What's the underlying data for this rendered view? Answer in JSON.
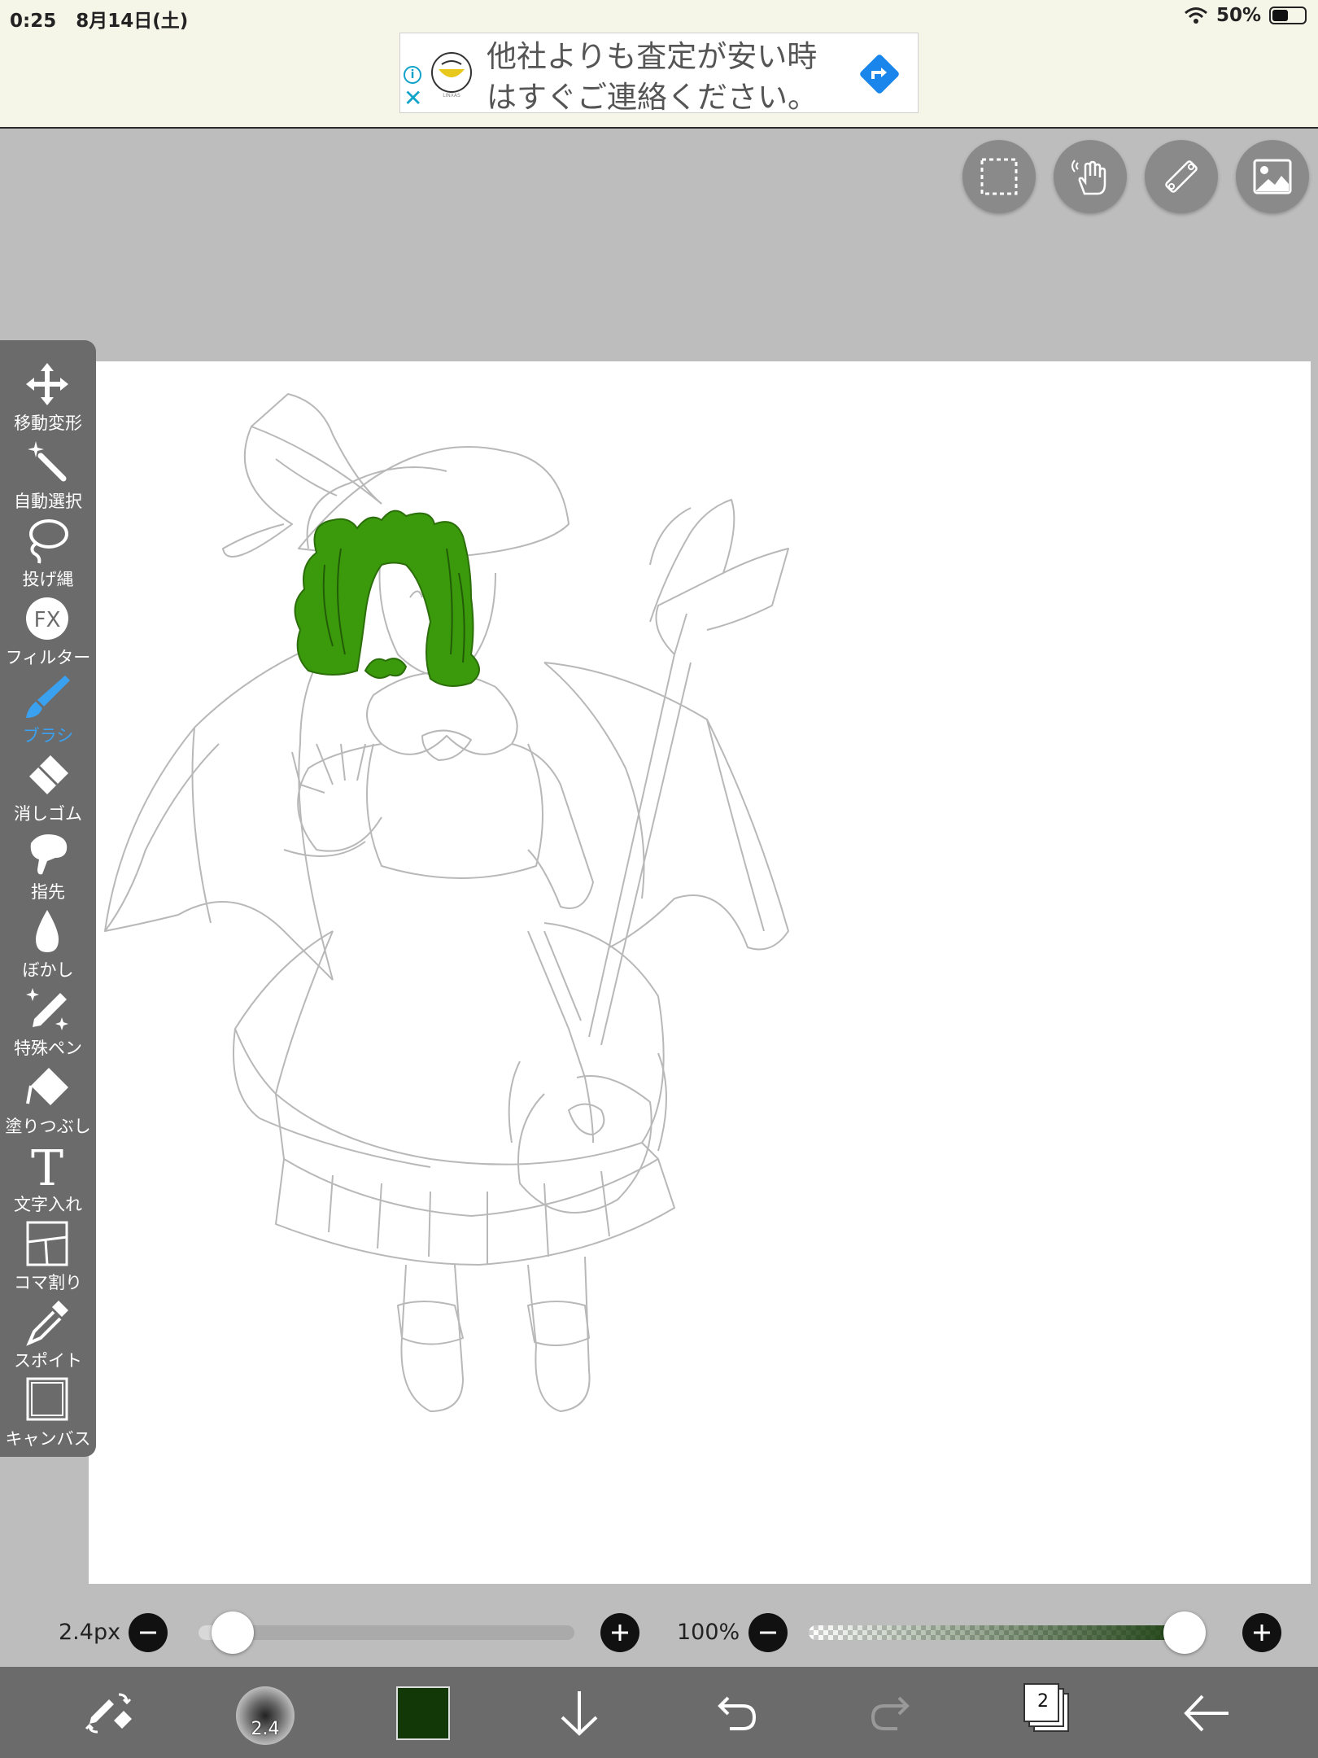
{
  "status": {
    "time": "0:25",
    "date": "8月14日(土)",
    "battery": "50%",
    "battery_level": 0.5
  },
  "ad": {
    "text": "他社よりも査定が安い時はすぐご連絡ください。",
    "info_icon": "i",
    "close_icon": "✕",
    "logo_text": "LINXAS"
  },
  "top_tools": [
    {
      "name": "selection-rect-icon"
    },
    {
      "name": "hand-gesture-icon"
    },
    {
      "name": "ruler-icon"
    },
    {
      "name": "image-material-icon"
    }
  ],
  "toolbar": {
    "items": [
      {
        "label": "移動変形",
        "icon": "move-transform-icon"
      },
      {
        "label": "自動選択",
        "icon": "magic-wand-icon"
      },
      {
        "label": "投げ縄",
        "icon": "lasso-icon"
      },
      {
        "label": "フィルター",
        "icon": "filter-fx-icon",
        "icon_text": "FX"
      },
      {
        "label": "ブラシ",
        "icon": "brush-icon",
        "active": true
      },
      {
        "label": "消しゴム",
        "icon": "eraser-icon"
      },
      {
        "label": "指先",
        "icon": "finger-smudge-icon"
      },
      {
        "label": "ぼかし",
        "icon": "blur-drop-icon"
      },
      {
        "label": "特殊ペン",
        "icon": "special-pen-icon"
      },
      {
        "label": "塗りつぶし",
        "icon": "bucket-fill-icon"
      },
      {
        "label": "文字入れ",
        "icon": "text-icon",
        "icon_text": "T"
      },
      {
        "label": "コマ割り",
        "icon": "frame-divide-icon"
      },
      {
        "label": "スポイト",
        "icon": "eyedropper-icon"
      },
      {
        "label": "キャンバス",
        "icon": "canvas-icon"
      }
    ]
  },
  "sliders": {
    "size_label": "2.4px",
    "size_fraction": 0.04,
    "opacity_label": "100%",
    "opacity_fraction": 1.0
  },
  "bottombar": {
    "brush_size": "2.4",
    "current_color": "#133808",
    "layer_count": "2"
  },
  "colors": {
    "hair_green": "#3a9a0c",
    "accent_blue": "#3aa0f0",
    "toolbar_bg": "#6b6b6b"
  }
}
